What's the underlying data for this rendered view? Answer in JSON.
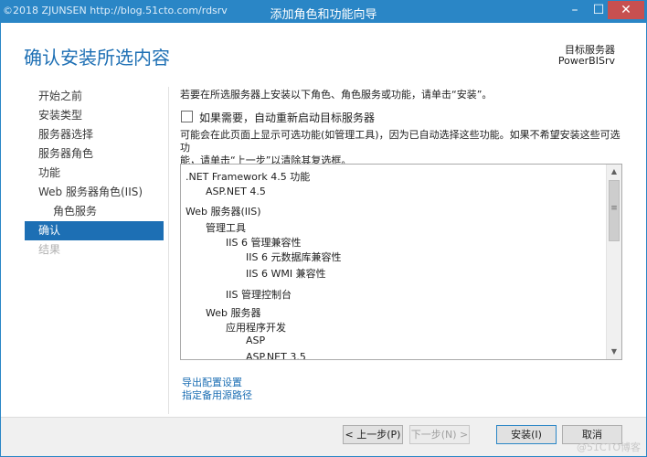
{
  "window": {
    "title": "添加角色和功能向导",
    "watermark_top": "©2018 ZJUNSEN http://blog.51cto.com/rdsrv",
    "minimize_glyph": "–",
    "maximize_glyph": "☐",
    "close_glyph": "✕"
  },
  "header": {
    "page_title": "确认安装所选内容",
    "server_label": "目标服务器",
    "server_name": "PowerBISrv"
  },
  "nav": {
    "items": [
      {
        "label": "开始之前"
      },
      {
        "label": "安装类型"
      },
      {
        "label": "服务器选择"
      },
      {
        "label": "服务器角色"
      },
      {
        "label": "功能"
      },
      {
        "label": "Web 服务器角色(IIS)"
      },
      {
        "label": "角色服务"
      },
      {
        "label": "确认"
      },
      {
        "label": "结果"
      }
    ]
  },
  "content": {
    "intro": "若要在所选服务器上安装以下角色、角色服务或功能，请单击“安装”。",
    "restart_label": "如果需要，自动重新启动目标服务器",
    "restart_checked": false,
    "note_line1": "可能会在此页面上显示可选功能(如管理工具)，因为已自动选择这些功能。如果不希望安装这些可选功",
    "note_line2": "能，请单击“上一步”以清除其复选框。",
    "features": [
      {
        "label": ".NET Framework 4.5 功能"
      },
      {
        "label": "ASP.NET 4.5"
      },
      {
        "label": "Web 服务器(IIS)"
      },
      {
        "label": "管理工具"
      },
      {
        "label": "IIS 6 管理兼容性"
      },
      {
        "label": "IIS 6 元数据库兼容性"
      },
      {
        "label": "IIS 6 WMI 兼容性"
      },
      {
        "label": "IIS 管理控制台"
      },
      {
        "label": "Web 服务器"
      },
      {
        "label": "应用程序开发"
      },
      {
        "label": "ASP"
      },
      {
        "label": "ASP.NET 3.5"
      }
    ],
    "export_link": "导出配置设置",
    "alt_source_link": "指定备用源路径"
  },
  "footer": {
    "prev": "< 上一步(P)",
    "next": "下一步(N) >",
    "install": "安装(I)",
    "cancel": "取消",
    "watermark_bottom": "@51CTO博客"
  }
}
